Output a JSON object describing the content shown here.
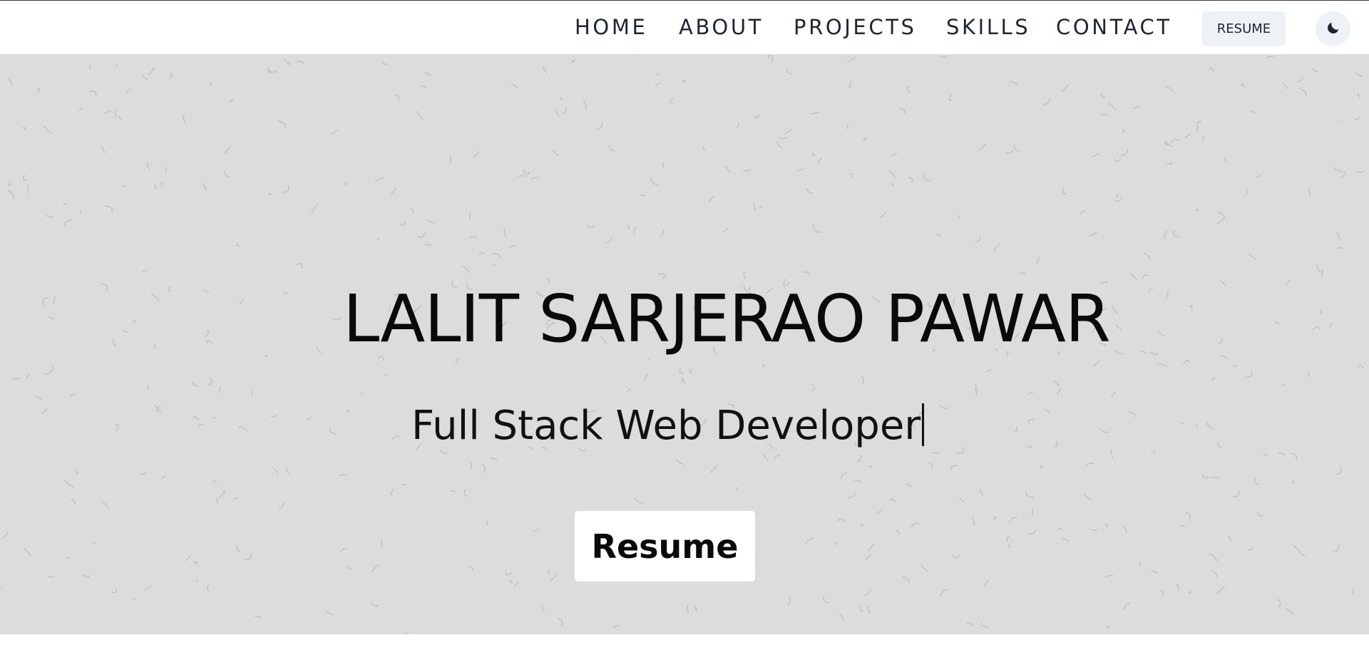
{
  "nav": {
    "links": [
      "HOME",
      "ABOUT",
      "PROJECTS",
      "SKILLS",
      "CONTACT"
    ],
    "resume_label": "RESUME",
    "theme_icon": "moon-icon"
  },
  "hero": {
    "title": "LALIT SARJERAO PAWAR",
    "subtitle": "Full Stack Web Developer",
    "resume_label": "Resume",
    "background_color": "#dcdcdd"
  },
  "colors": {
    "nav_text": "#1f2533",
    "nav_button_bg": "#eef1f5"
  }
}
